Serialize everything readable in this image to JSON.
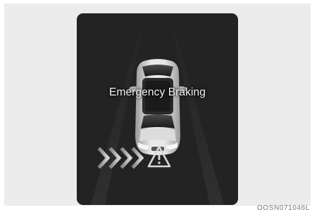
{
  "display": {
    "message": "Emergency Braking",
    "icons": {
      "vehicle": "car-top-view-icon",
      "approach": "approach-chevrons-icon",
      "warning": "warning-triangle-icon"
    },
    "colors": {
      "screen_background": "#232323",
      "text": "#f2f2f2",
      "icon": "#d9d9d9"
    }
  },
  "figure": {
    "code": "OOSN071046L"
  }
}
